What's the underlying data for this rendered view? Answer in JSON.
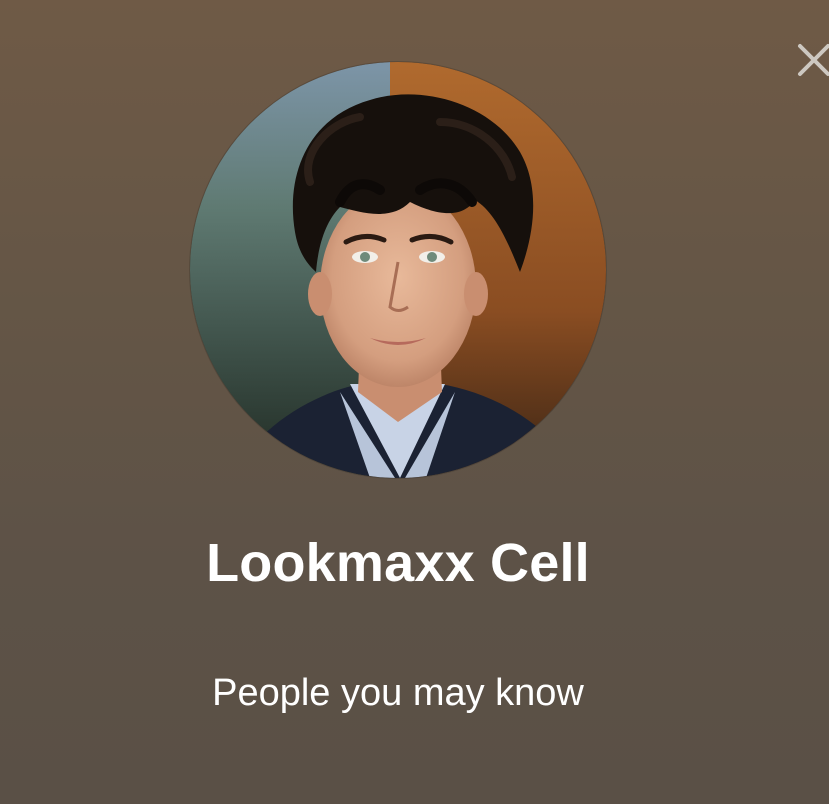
{
  "profile": {
    "name": "Lookmaxx Cell",
    "subtitle": "People you may know",
    "avatar_description": "profile-photo"
  },
  "controls": {
    "close_icon": "close-icon"
  },
  "colors": {
    "background_top": "#6f5a46",
    "background_bottom": "#5a5046",
    "text": "#ffffff",
    "close_icon": "#c9c4bd"
  }
}
